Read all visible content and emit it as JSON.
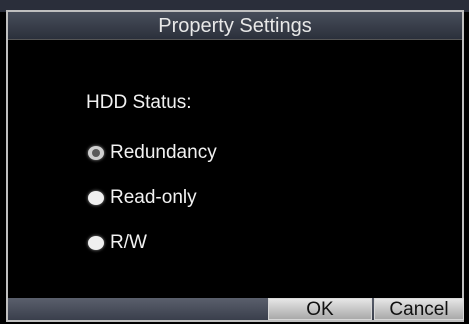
{
  "dialog": {
    "title": "Property Settings",
    "hdd_status_label": "HDD Status:",
    "options": [
      {
        "label": "Redundancy",
        "selected": true
      },
      {
        "label": "Read-only",
        "selected": false
      },
      {
        "label": "R/W",
        "selected": false
      }
    ],
    "buttons": {
      "ok": "OK",
      "cancel": "Cancel"
    }
  }
}
